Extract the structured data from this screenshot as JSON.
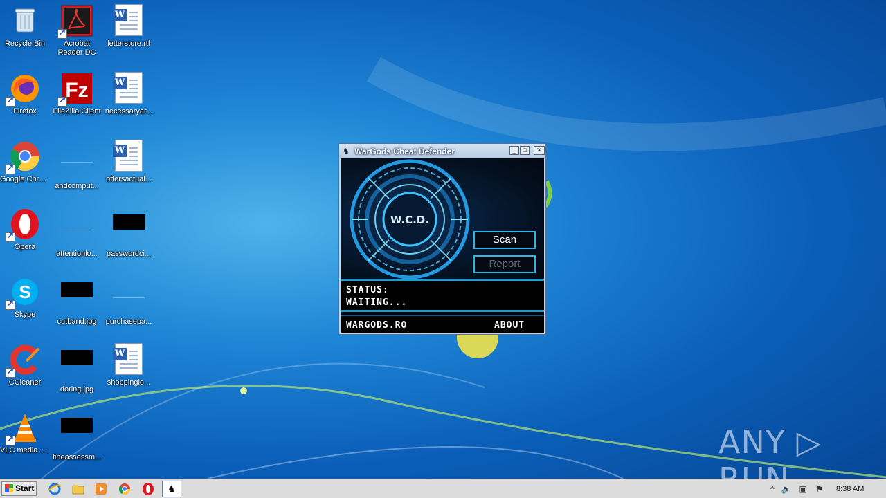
{
  "desktop": {
    "icons": [
      {
        "label": "Recycle Bin",
        "icon": "recycle-bin-icon"
      },
      {
        "label": "Acrobat Reader DC",
        "icon": "acrobat-icon"
      },
      {
        "label": "letterstore.rtf",
        "icon": "word-doc-icon"
      },
      {
        "label": "Firefox",
        "icon": "firefox-icon"
      },
      {
        "label": "FileZilla Client",
        "icon": "filezilla-icon"
      },
      {
        "label": "necessaryar...",
        "icon": "word-doc-icon"
      },
      {
        "label": "Google Chrome",
        "icon": "chrome-icon"
      },
      {
        "label": "andcomput...",
        "icon": "file-icon"
      },
      {
        "label": "offersactual...",
        "icon": "word-doc-icon"
      },
      {
        "label": "Opera",
        "icon": "opera-icon"
      },
      {
        "label": "attentionlo...",
        "icon": "file-icon"
      },
      {
        "label": "passwordci...",
        "icon": "image-thumb-icon"
      },
      {
        "label": "Skype",
        "icon": "skype-icon"
      },
      {
        "label": "cutband.jpg",
        "icon": "image-thumb-icon"
      },
      {
        "label": "purchasepa...",
        "icon": "file-icon"
      },
      {
        "label": "CCleaner",
        "icon": "ccleaner-icon"
      },
      {
        "label": "doring.jpg",
        "icon": "image-thumb-icon"
      },
      {
        "label": "shoppinglo...",
        "icon": "word-doc-icon"
      },
      {
        "label": "VLC media player",
        "icon": "vlc-icon"
      },
      {
        "label": "fineassessm...",
        "icon": "image-thumb-icon"
      }
    ]
  },
  "window": {
    "title": "WarGods Cheat Defender",
    "minimize": "_",
    "maximize": "□",
    "close": "✕",
    "logo_text": "W.C.D.",
    "scan_label": "Scan",
    "report_label": "Report",
    "status_label": "STATUS:",
    "status_value": "WAITING...",
    "site_link": "WARGODS.RO",
    "about_link": "ABOUT",
    "colors": {
      "accent": "#2fb6e8",
      "panel": "#000000"
    }
  },
  "taskbar": {
    "start_label": "Start",
    "clock": "8:38 AM",
    "pinned": [
      "internet-explorer-icon",
      "explorer-icon",
      "media-player-icon",
      "chrome-icon",
      "opera-icon",
      "wargods-app-icon"
    ],
    "tray": [
      "show-hidden-icon",
      "volume-icon",
      "network-icon",
      "action-center-flag-icon"
    ]
  },
  "watermark": "ANY ▷ RUN"
}
